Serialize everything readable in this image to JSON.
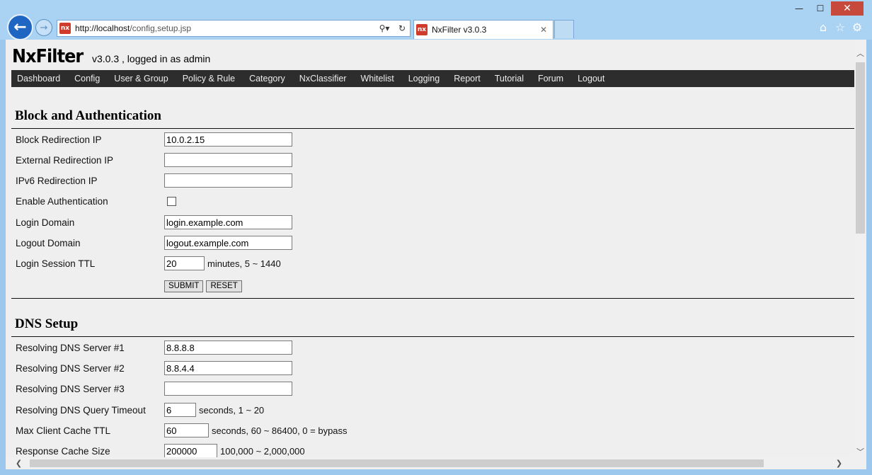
{
  "browser": {
    "url_host": "http://localhost",
    "url_path": "/config,setup.jsp",
    "tab_title": "NxFilter v3.0.3",
    "favicon_text": "nx",
    "search_glyph": "⚲▾",
    "refresh_glyph": "↻",
    "tab_close_glyph": "✕",
    "back_glyph": "←",
    "forward_glyph": "→",
    "minimize_glyph": "—",
    "maximize_glyph": "☐",
    "close_glyph": "✕",
    "home_glyph": "⌂",
    "favorites_glyph": "☆",
    "settings_glyph": "⚙"
  },
  "header": {
    "brand": "NxFilter",
    "info": "v3.0.3 , logged in as admin"
  },
  "nav": [
    "Dashboard",
    "Config",
    "User & Group",
    "Policy & Rule",
    "Category",
    "NxClassifier",
    "Whitelist",
    "Logging",
    "Report",
    "Tutorial",
    "Forum",
    "Logout"
  ],
  "block_auth": {
    "title": "Block and Authentication",
    "block_redirection_ip_label": "Block Redirection IP",
    "block_redirection_ip": "10.0.2.15",
    "external_redirection_ip_label": "External Redirection IP",
    "external_redirection_ip": "",
    "ipv6_redirection_ip_label": "IPv6 Redirection IP",
    "ipv6_redirection_ip": "",
    "enable_authentication_label": "Enable Authentication",
    "enable_authentication": false,
    "login_domain_label": "Login Domain",
    "login_domain": "login.example.com",
    "logout_domain_label": "Logout Domain",
    "logout_domain": "logout.example.com",
    "login_session_ttl_label": "Login Session TTL",
    "login_session_ttl": "20",
    "login_session_ttl_hint": "minutes, 5 ~ 1440",
    "submit_label": "SUBMIT",
    "reset_label": "RESET"
  },
  "dns_setup": {
    "title": "DNS Setup",
    "server1_label": "Resolving DNS Server #1",
    "server1": "8.8.8.8",
    "server2_label": "Resolving DNS Server #2",
    "server2": "8.8.4.4",
    "server3_label": "Resolving DNS Server #3",
    "server3": "",
    "query_timeout_label": "Resolving DNS Query Timeout",
    "query_timeout": "6",
    "query_timeout_hint": "seconds, 1 ~ 20",
    "max_client_cache_ttl_label": "Max Client Cache TTL",
    "max_client_cache_ttl": "60",
    "max_client_cache_ttl_hint": "seconds, 60 ~ 86400, 0 = bypass",
    "response_cache_size_label": "Response Cache Size",
    "response_cache_size": "200000",
    "response_cache_size_hint": "100,000 ~ 2,000,000"
  },
  "scrollbar": {
    "up_glyph": "︿",
    "down_glyph": "﹀",
    "left_glyph": "❮",
    "right_glyph": "❯"
  }
}
